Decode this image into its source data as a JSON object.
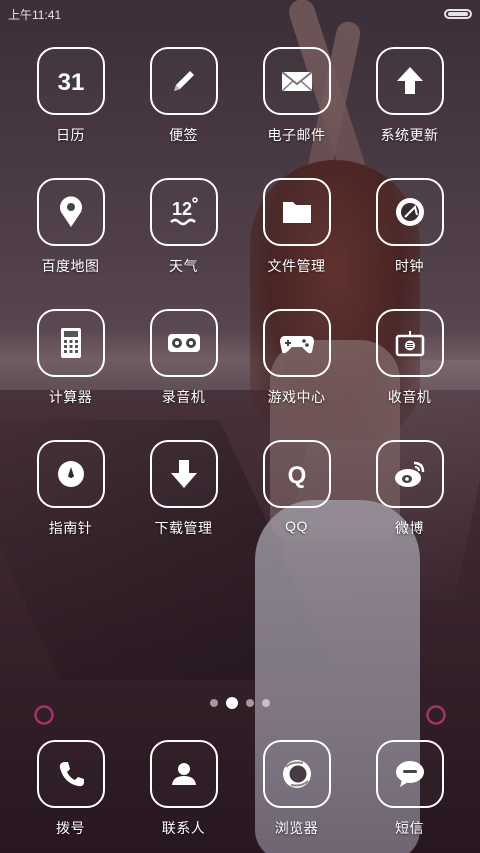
{
  "status_bar": {
    "time": "上午11:41"
  },
  "apps": [
    {
      "label": "日历",
      "icon": "calendar-icon",
      "glyph": "31"
    },
    {
      "label": "便签",
      "icon": "pencil-icon"
    },
    {
      "label": "电子邮件",
      "icon": "envelope-icon"
    },
    {
      "label": "系统更新",
      "icon": "upload-arrow-icon"
    },
    {
      "label": "百度地图",
      "icon": "map-pin-icon"
    },
    {
      "label": "天气",
      "icon": "weather-icon",
      "glyph": "12"
    },
    {
      "label": "文件管理",
      "icon": "folder-icon"
    },
    {
      "label": "时钟",
      "icon": "clock-icon"
    },
    {
      "label": "计算器",
      "icon": "calculator-icon"
    },
    {
      "label": "录音机",
      "icon": "tape-recorder-icon"
    },
    {
      "label": "游戏中心",
      "icon": "gamepad-icon"
    },
    {
      "label": "收音机",
      "icon": "radio-icon"
    },
    {
      "label": "指南针",
      "icon": "compass-icon"
    },
    {
      "label": "下载管理",
      "icon": "download-arrow-icon"
    },
    {
      "label": "QQ",
      "icon": "qq-icon",
      "glyph": "Q"
    },
    {
      "label": "微博",
      "icon": "weibo-icon"
    }
  ],
  "pager": {
    "page_count": 4,
    "active_index": 1
  },
  "dock": [
    {
      "label": "拨号",
      "icon": "phone-icon"
    },
    {
      "label": "联系人",
      "icon": "person-icon"
    },
    {
      "label": "浏览器",
      "icon": "browser-ring-icon"
    },
    {
      "label": "短信",
      "icon": "message-bubble-icon"
    }
  ],
  "colors": {
    "icon_stroke": "#ffffff",
    "divider_accent": "#a0336a",
    "label_text": "#ffffff"
  }
}
